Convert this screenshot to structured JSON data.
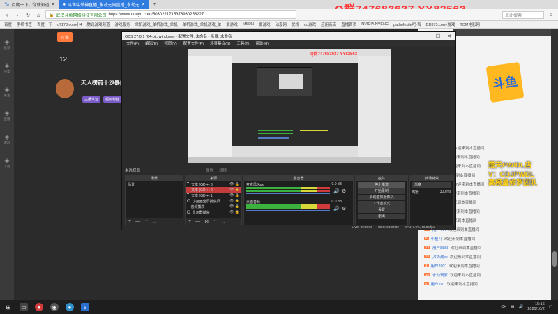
{
  "browser": {
    "tabs": [
      {
        "label": "百度一下，你就知道",
        "active": false
      },
      {
        "label": "斗鱼中杀神直播_永劫无间直播_永劫无",
        "active": true
      }
    ],
    "url_security": "武汉斗鱼网络科技有限公司",
    "url": "https://www.douyu.com/5030221715376930253227",
    "search_placeholder": "点此搜索",
    "bookmarks": [
      "百度",
      "手机书签",
      "百度一下",
      "c7173.com小4",
      "腾讯游戏频道",
      "游戏服务",
      "单机游戏_单机游戏_单机",
      "单机游戏_单机游戏_单",
      "爱游戏",
      "MSDN",
      "爱游戏",
      "动漫网",
      "优视",
      "uu游戏",
      "应用商店",
      "直播首页",
      "NVIDIA NVENC",
      "pathofexile吧-百",
      "DD373.com-游戏",
      "TOM电影网"
    ]
  },
  "overlay_qq": "Q群747683637    YY82563",
  "douyu": {
    "logo_text": "斗鱼",
    "rank_num": "12",
    "streamer_title": "天人榜前十沙暴阔刀",
    "badges": [
      "主播认证",
      "超级粉丝",
      "贵族"
    ],
    "sidebar": [
      "推荐",
      "分类",
      "关注",
      "直播",
      "游戏",
      "下载"
    ],
    "promo_text": "斗鱼",
    "chat": [
      {
        "level": "12",
        "name": "用户PK247",
        "text": "欢迎来到本直播间"
      },
      {
        "level": "8",
        "name": "用户3891",
        "text": "欢迎来到本直播间"
      },
      {
        "level": "15",
        "name": "清风徐来",
        "text": "欢迎来到本直播间"
      },
      {
        "level": "6",
        "name": "夜行者",
        "text": "欢迎来到本直播间"
      },
      {
        "level": "20",
        "name": "无敌小可爱",
        "text": "欢迎来到本直播间"
      },
      {
        "level": "9",
        "name": "用户1024",
        "text": "欢迎来到本直播间"
      },
      {
        "level": "11",
        "name": "风之子",
        "text": "欢迎来到本直播间"
      },
      {
        "level": "7",
        "name": "用户5566",
        "text": "欢迎来到本直播间"
      },
      {
        "level": "13",
        "name": "南山南",
        "text": "欢迎来到本直播间"
      },
      {
        "level": "10",
        "name": "用户777",
        "text": "欢迎来到本直播间"
      },
      {
        "level": "5",
        "name": "小鱼儿",
        "text": "欢迎来到本直播间"
      },
      {
        "level": "14",
        "name": "用户8888",
        "text": "欢迎来到本直播间"
      },
      {
        "level": "18",
        "name": "刀锋战士",
        "text": "欢迎来到本直播间"
      },
      {
        "level": "3",
        "name": "用户2021",
        "text": "欢迎来到本直播间"
      },
      {
        "level": "16",
        "name": "永劫玩家",
        "text": "欢迎来到本直播间"
      },
      {
        "level": "4",
        "name": "用户101",
        "text": "欢迎来到本直播间"
      }
    ],
    "gold_overlay": [
      "楚天PW/DL店",
      "V：CDJPWDL",
      "高模量修罗团队"
    ]
  },
  "obs": {
    "title": "OBS 27.0.1 (64-bit, windows) - 配置文件: 未命名 - 场景: 未命名",
    "menu": [
      "文件(F)",
      "编辑(E)",
      "视图(V)",
      "配置文件(P)",
      "场景集合(S)",
      "工具(T)",
      "帮助(H)"
    ],
    "preview_qq": "Q群747683637    YY82563",
    "no_source_hint": "未选择源",
    "source_tabs": [
      "属性",
      "滤镜"
    ],
    "docks": {
      "scenes": {
        "header": "场景",
        "items": [
          "场景"
        ]
      },
      "sources": {
        "header": "来源",
        "items": [
          {
            "name": "文本 (GDI+) 3",
            "type": "T",
            "selected": false
          },
          {
            "name": "文本 (GDI+) 2",
            "type": "T",
            "selected": true
          },
          {
            "name": "文本 (GDI+) 1",
            "type": "T",
            "selected": false
          },
          {
            "name": "小画面全屏捕获屏",
            "type": "▢",
            "selected": false
          },
          {
            "name": "音频捕获",
            "type": "♪",
            "selected": false
          },
          {
            "name": "显示器捕获",
            "type": "▢",
            "selected": false
          }
        ]
      },
      "mixer": {
        "header": "混音器",
        "channels": [
          {
            "name": "麦克风/Aux",
            "db": "0.0 dB"
          },
          {
            "name": "桌面音频",
            "db": "0.0 dB"
          }
        ]
      },
      "controls": {
        "header": "控件",
        "buttons": [
          "停止推流",
          "开始录制",
          "启动虚拟摄像机",
          "工作室模式",
          "设置",
          "退出"
        ]
      },
      "transitions": {
        "header": "转场特效",
        "selected": "渐变",
        "duration_label": "时长",
        "duration": "300 ms"
      }
    },
    "status": {
      "live": "LIVE: 00:00:00",
      "rec": "REC: 00:00:00",
      "cpu": "CPU: 1.9%, 60.00 fps"
    }
  },
  "taskbar": {
    "tray_lang": "CH",
    "time": "15:16",
    "date": "2021/10/2"
  },
  "colors": {
    "accent_red": "#ff3838",
    "gold": "#ffd21c",
    "obs_selected": "#c43c3c",
    "browser_tab": "#2f7be0"
  }
}
